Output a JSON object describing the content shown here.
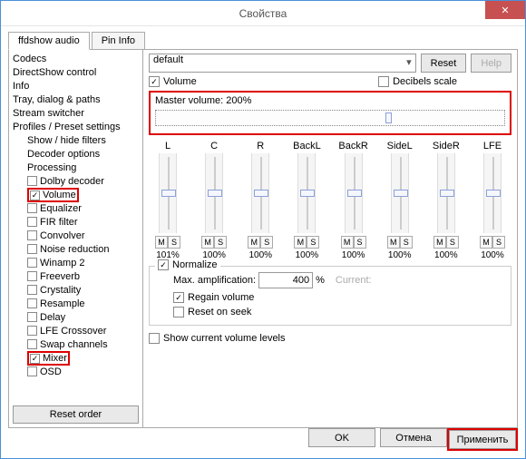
{
  "window": {
    "title": "Свойства"
  },
  "tabs": {
    "active": "ffdshow audio",
    "inactive": "Pin Info"
  },
  "tree": {
    "items": [
      {
        "label": "Codecs",
        "indent": 0,
        "cb": null
      },
      {
        "label": "DirectShow control",
        "indent": 0,
        "cb": null
      },
      {
        "label": "Info",
        "indent": 0,
        "cb": null
      },
      {
        "label": "Tray, dialog & paths",
        "indent": 0,
        "cb": null
      },
      {
        "label": "Stream switcher",
        "indent": 0,
        "cb": null
      },
      {
        "label": "Profiles / Preset settings",
        "indent": 0,
        "cb": null
      },
      {
        "label": "Show / hide filters",
        "indent": 1,
        "cb": null
      },
      {
        "label": "Decoder options",
        "indent": 1,
        "cb": null
      },
      {
        "label": "Processing",
        "indent": 1,
        "cb": null
      },
      {
        "label": "Dolby decoder",
        "indent": 1,
        "cb": false
      },
      {
        "label": "Volume",
        "indent": 1,
        "cb": true,
        "hi": true
      },
      {
        "label": "Equalizer",
        "indent": 1,
        "cb": false
      },
      {
        "label": "FIR filter",
        "indent": 1,
        "cb": false
      },
      {
        "label": "Convolver",
        "indent": 1,
        "cb": false
      },
      {
        "label": "Noise reduction",
        "indent": 1,
        "cb": false
      },
      {
        "label": "Winamp 2",
        "indent": 1,
        "cb": false
      },
      {
        "label": "Freeverb",
        "indent": 1,
        "cb": false
      },
      {
        "label": "Crystality",
        "indent": 1,
        "cb": false
      },
      {
        "label": "Resample",
        "indent": 1,
        "cb": false
      },
      {
        "label": "Delay",
        "indent": 1,
        "cb": false
      },
      {
        "label": "LFE Crossover",
        "indent": 1,
        "cb": false
      },
      {
        "label": "Swap channels",
        "indent": 1,
        "cb": false
      },
      {
        "label": "Mixer",
        "indent": 1,
        "cb": true,
        "hi": true
      },
      {
        "label": "OSD",
        "indent": 1,
        "cb": false
      }
    ],
    "reset_order": "Reset order"
  },
  "right": {
    "preset": "default",
    "reset": "Reset",
    "help": "Help",
    "volume_cb": "Volume",
    "decibels_cb": "Decibels scale",
    "master_label": "Master volume: 200%",
    "channels": [
      {
        "name": "L",
        "val": "101%"
      },
      {
        "name": "C",
        "val": "100%"
      },
      {
        "name": "R",
        "val": "100%"
      },
      {
        "name": "BackL",
        "val": "100%"
      },
      {
        "name": "BackR",
        "val": "100%"
      },
      {
        "name": "SideL",
        "val": "100%"
      },
      {
        "name": "SideR",
        "val": "100%"
      },
      {
        "name": "LFE",
        "val": "100%"
      }
    ],
    "ms": {
      "m": "M",
      "s": "S"
    },
    "normalize": "Normalize",
    "max_amp_label": "Max. amplification:",
    "max_amp_value": "400",
    "pct": "%",
    "current": "Current:",
    "regain": "Regain volume",
    "reset_seek": "Reset on seek",
    "show_levels": "Show current volume levels"
  },
  "buttons": {
    "ok": "OK",
    "cancel": "Отмена",
    "apply": "Применить"
  }
}
